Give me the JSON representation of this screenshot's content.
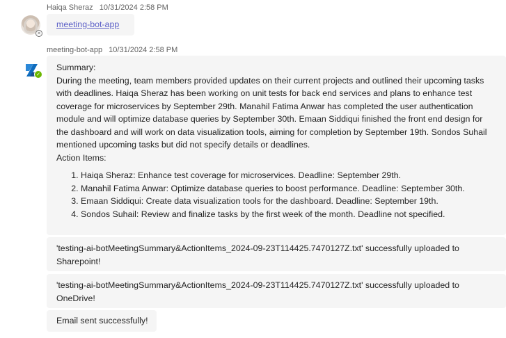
{
  "messages": [
    {
      "sender": "Haiqa Sheraz",
      "timestamp": "10/31/2024 2:58 PM",
      "link_text": "meeting-bot-app"
    },
    {
      "sender": "meeting-bot-app",
      "timestamp": "10/31/2024 2:58 PM",
      "summary_heading": "Summary:",
      "summary_body": "During the meeting, team members provided updates on their current projects and outlined their upcoming tasks with deadlines. Haiqa Sheraz has been working on unit tests for back end services and plans to enhance test coverage for microservices by September 29th. Manahil Fatima Anwar has completed the user authentication module and will optimize database queries by September 30th. Emaan Siddiqui finished the front end design for the dashboard and will work on data visualization tools, aiming for completion by September 19th. Sondos Suhail mentioned upcoming tasks but did not specify details or deadlines.",
      "action_heading": "Action Items:",
      "action_items": [
        "Haiqa Sheraz: Enhance test coverage for microservices. Deadline: September 29th.",
        "Manahil Fatima Anwar: Optimize database queries to boost performance. Deadline: September 30th.",
        "Emaan Siddiqui: Create data visualization tools for the dashboard. Deadline: September 19th.",
        "Sondos Suhail: Review and finalize tasks by the first week of the month. Deadline not specified."
      ],
      "upload_sharepoint": "'testing-ai-botMeetingSummary&ActionItems_2024-09-23T114425.7470127Z.txt' successfully uploaded to Sharepoint!",
      "upload_onedrive": "'testing-ai-botMeetingSummary&ActionItems_2024-09-23T114425.7470127Z.txt' successfully uploaded to OneDrive!",
      "email_status": "Email sent successfully!"
    }
  ],
  "icons": {
    "user_status": "offline-status-icon",
    "bot_status": "available-status-icon",
    "bot_logo": "bot-app-icon"
  },
  "colors": {
    "link": "#5b5fc7",
    "bubble": "#f5f5f5",
    "available": "#6bb700",
    "bot_logo_blue": "#0f6cbd"
  }
}
